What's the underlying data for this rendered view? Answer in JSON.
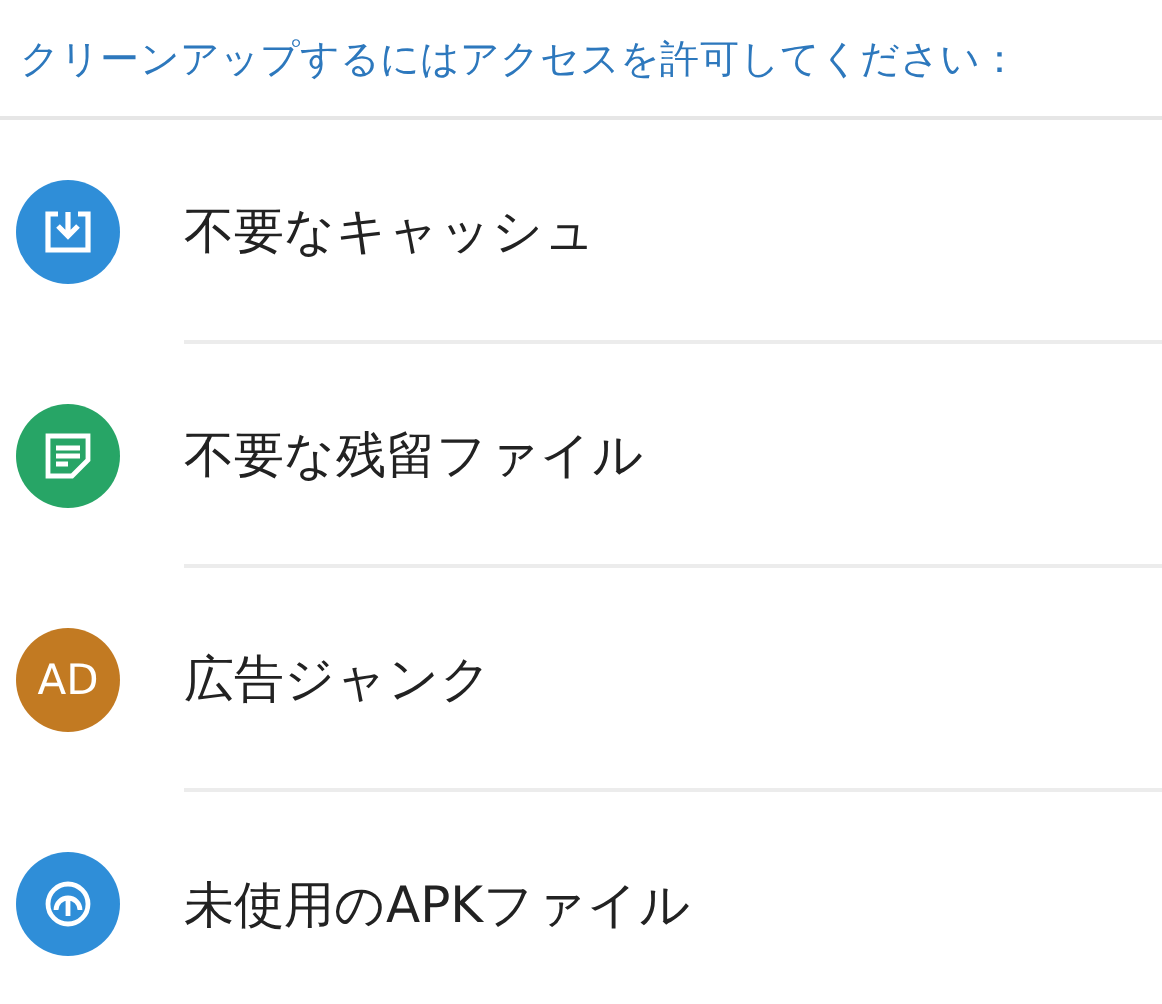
{
  "header": {
    "text": "クリーンアップするにはアクセスを許可してください："
  },
  "items": [
    {
      "label": "不要なキャッシュ",
      "kind": "download",
      "color": "#2f8ed8"
    },
    {
      "label": "不要な残留ファイル",
      "kind": "note",
      "color": "#27a566"
    },
    {
      "label": "広告ジャンク",
      "kind": "text",
      "color": "#c27a22",
      "icon_text": "AD"
    },
    {
      "label": "未使用のAPKファイル",
      "kind": "gauge",
      "color": "#2f8ed8"
    }
  ]
}
